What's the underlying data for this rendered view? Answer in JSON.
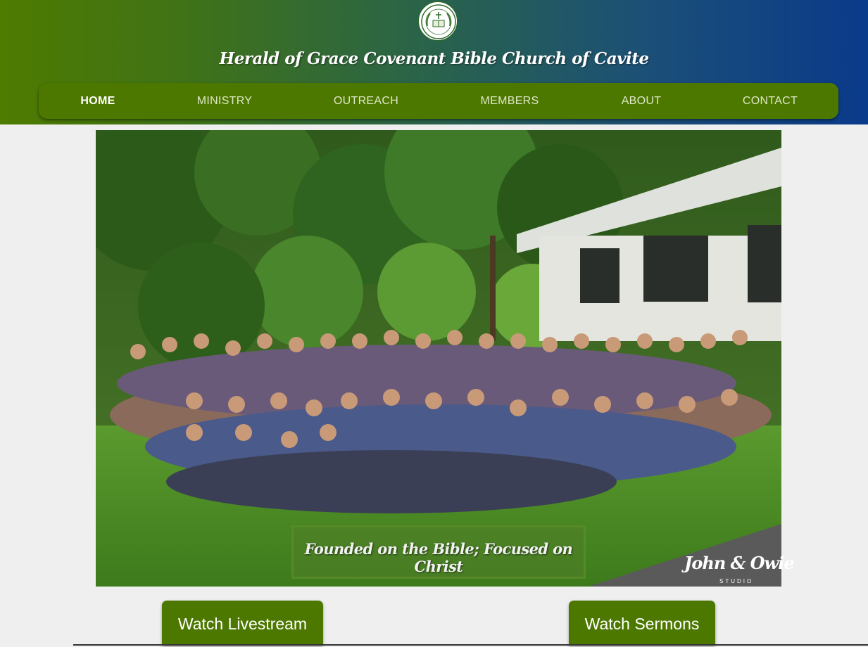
{
  "header": {
    "title": "Herald of Grace Covenant Bible Church of Cavite",
    "logo_icon": "church-seal-logo"
  },
  "nav": {
    "items": [
      {
        "label": "HOME",
        "active": true
      },
      {
        "label": "MINISTRY",
        "active": false
      },
      {
        "label": "OUTREACH",
        "active": false
      },
      {
        "label": "MEMBERS",
        "active": false
      },
      {
        "label": "ABOUT",
        "active": false
      },
      {
        "label": "CONTACT",
        "active": false
      }
    ]
  },
  "hero": {
    "tagline": "Founded on the Bible; Focused on Christ",
    "watermark": "John & Owie",
    "watermark_sub": "STUDIO"
  },
  "actions": {
    "livestream_label": "Watch Livestream",
    "sermons_label": "Watch Sermons"
  },
  "colors": {
    "brand_green": "#4d7800",
    "header_gradient_start": "#4e7b00",
    "header_gradient_end": "#0a3a8a",
    "page_background": "#efefef"
  }
}
